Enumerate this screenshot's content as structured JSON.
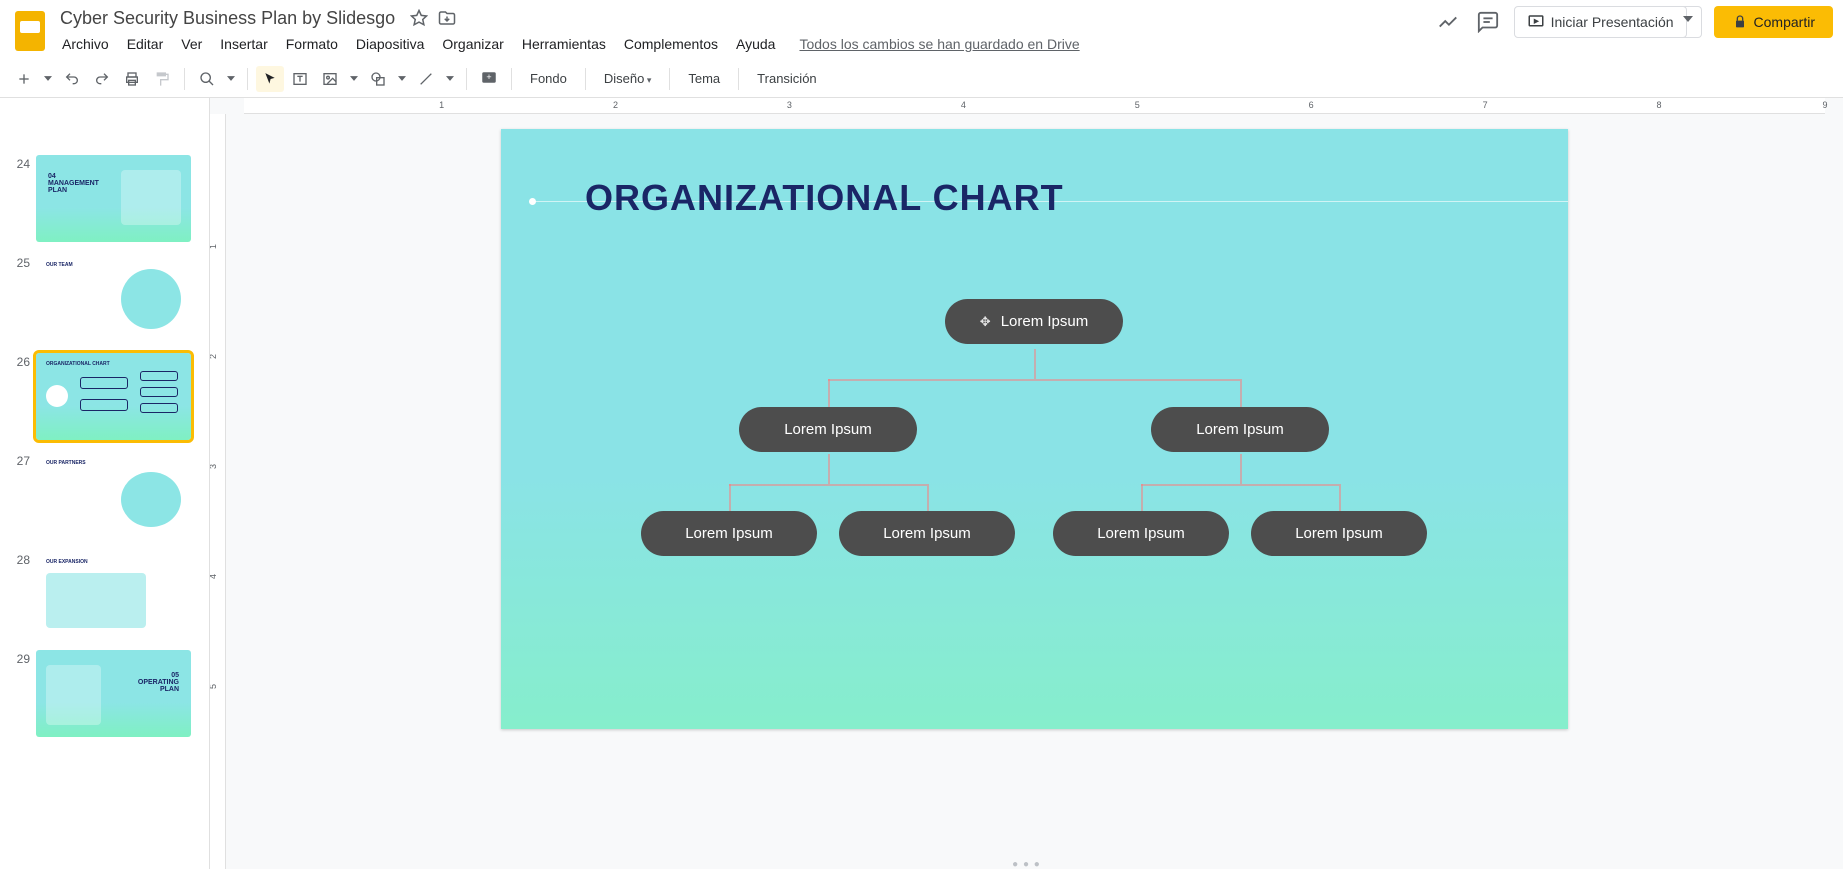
{
  "header": {
    "doc_title": "Cyber Security Business Plan by Slidesgo",
    "present_label": "Iniciar Presentación",
    "share_label": "Compartir"
  },
  "menu": {
    "items": [
      "Archivo",
      "Editar",
      "Ver",
      "Insertar",
      "Formato",
      "Diapositiva",
      "Organizar",
      "Herramientas",
      "Complementos",
      "Ayuda"
    ],
    "save_status": "Todos los cambios se han guardado en Drive"
  },
  "toolbar": {
    "background": "Fondo",
    "design": "Diseño",
    "theme": "Tema",
    "transition": "Transición"
  },
  "filmstrip": {
    "slides": [
      {
        "num": "",
        "title": ""
      },
      {
        "num": "24",
        "title": "04 MANAGEMENT PLAN"
      },
      {
        "num": "25",
        "title": "OUR TEAM"
      },
      {
        "num": "26",
        "title": "ORGANIZATIONAL CHART"
      },
      {
        "num": "27",
        "title": "OUR PARTNERS"
      },
      {
        "num": "28",
        "title": "OUR EXPANSION"
      },
      {
        "num": "29",
        "title": "05 OPERATING PLAN"
      }
    ]
  },
  "canvas": {
    "heading": "ORGANIZATIONAL CHART",
    "nodes": {
      "root": "Lorem Ipsum",
      "l2a": "Lorem Ipsum",
      "l2b": "Lorem Ipsum",
      "l3a": "Lorem Ipsum",
      "l3b": "Lorem Ipsum",
      "l3c": "Lorem Ipsum",
      "l3d": "Lorem Ipsum"
    }
  },
  "ruler_h": [
    "1",
    "2",
    "3",
    "4",
    "5",
    "6",
    "7",
    "8",
    "9"
  ],
  "ruler_v": [
    "1",
    "2",
    "3",
    "4",
    "5"
  ]
}
